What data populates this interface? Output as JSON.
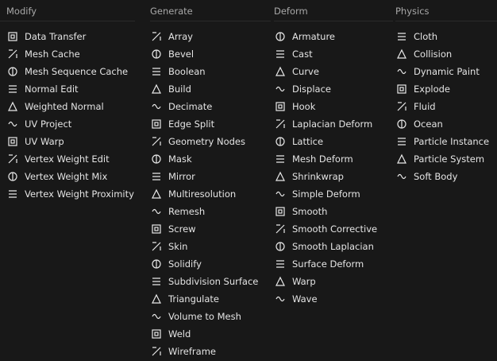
{
  "columns": [
    {
      "header": "Modify",
      "items": [
        {
          "label": "Data Transfer",
          "icon": "data-transfer-icon"
        },
        {
          "label": "Mesh Cache",
          "icon": "mesh-cache-icon"
        },
        {
          "label": "Mesh Sequence Cache",
          "icon": "mesh-sequence-cache-icon"
        },
        {
          "label": "Normal Edit",
          "icon": "normal-edit-icon"
        },
        {
          "label": "Weighted Normal",
          "icon": "weighted-normal-icon"
        },
        {
          "label": "UV Project",
          "icon": "uv-project-icon"
        },
        {
          "label": "UV Warp",
          "icon": "uv-warp-icon"
        },
        {
          "label": "Vertex Weight Edit",
          "icon": "vertex-weight-edit-icon"
        },
        {
          "label": "Vertex Weight Mix",
          "icon": "vertex-weight-mix-icon"
        },
        {
          "label": "Vertex Weight Proximity",
          "icon": "vertex-weight-proximity-icon"
        }
      ]
    },
    {
      "header": "Generate",
      "items": [
        {
          "label": "Array",
          "icon": "array-icon"
        },
        {
          "label": "Bevel",
          "icon": "bevel-icon"
        },
        {
          "label": "Boolean",
          "icon": "boolean-icon"
        },
        {
          "label": "Build",
          "icon": "build-icon"
        },
        {
          "label": "Decimate",
          "icon": "decimate-icon"
        },
        {
          "label": "Edge Split",
          "icon": "edge-split-icon"
        },
        {
          "label": "Geometry Nodes",
          "icon": "geometry-nodes-icon"
        },
        {
          "label": "Mask",
          "icon": "mask-icon"
        },
        {
          "label": "Mirror",
          "icon": "mirror-icon"
        },
        {
          "label": "Multiresolution",
          "icon": "multiresolution-icon"
        },
        {
          "label": "Remesh",
          "icon": "remesh-icon"
        },
        {
          "label": "Screw",
          "icon": "screw-icon"
        },
        {
          "label": "Skin",
          "icon": "skin-icon"
        },
        {
          "label": "Solidify",
          "icon": "solidify-icon"
        },
        {
          "label": "Subdivision Surface",
          "icon": "subdivision-surface-icon"
        },
        {
          "label": "Triangulate",
          "icon": "triangulate-icon"
        },
        {
          "label": "Volume to Mesh",
          "icon": "volume-to-mesh-icon"
        },
        {
          "label": "Weld",
          "icon": "weld-icon"
        },
        {
          "label": "Wireframe",
          "icon": "wireframe-icon"
        }
      ]
    },
    {
      "header": "Deform",
      "items": [
        {
          "label": "Armature",
          "icon": "armature-icon"
        },
        {
          "label": "Cast",
          "icon": "cast-icon"
        },
        {
          "label": "Curve",
          "icon": "curve-icon"
        },
        {
          "label": "Displace",
          "icon": "displace-icon"
        },
        {
          "label": "Hook",
          "icon": "hook-icon"
        },
        {
          "label": "Laplacian Deform",
          "icon": "laplacian-deform-icon"
        },
        {
          "label": "Lattice",
          "icon": "lattice-icon"
        },
        {
          "label": "Mesh Deform",
          "icon": "mesh-deform-icon"
        },
        {
          "label": "Shrinkwrap",
          "icon": "shrinkwrap-icon"
        },
        {
          "label": "Simple Deform",
          "icon": "simple-deform-icon"
        },
        {
          "label": "Smooth",
          "icon": "smooth-icon"
        },
        {
          "label": "Smooth Corrective",
          "icon": "smooth-corrective-icon"
        },
        {
          "label": "Smooth Laplacian",
          "icon": "smooth-laplacian-icon"
        },
        {
          "label": "Surface Deform",
          "icon": "surface-deform-icon"
        },
        {
          "label": "Warp",
          "icon": "warp-icon"
        },
        {
          "label": "Wave",
          "icon": "wave-icon"
        }
      ]
    },
    {
      "header": "Physics",
      "items": [
        {
          "label": "Cloth",
          "icon": "cloth-icon"
        },
        {
          "label": "Collision",
          "icon": "collision-icon"
        },
        {
          "label": "Dynamic Paint",
          "icon": "dynamic-paint-icon"
        },
        {
          "label": "Explode",
          "icon": "explode-icon"
        },
        {
          "label": "Fluid",
          "icon": "fluid-icon"
        },
        {
          "label": "Ocean",
          "icon": "ocean-icon"
        },
        {
          "label": "Particle Instance",
          "icon": "particle-instance-icon"
        },
        {
          "label": "Particle System",
          "icon": "particle-system-icon"
        },
        {
          "label": "Soft Body",
          "icon": "soft-body-icon"
        }
      ]
    }
  ],
  "colors": {
    "background": "#181818",
    "text": "#e4e4e4",
    "header": "#a8a8a8"
  }
}
